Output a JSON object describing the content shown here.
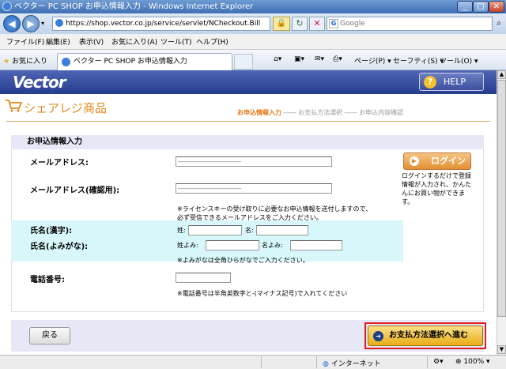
{
  "window": {
    "title": "ベクター PC SHOP お申込情報入力 - Windows Internet Explorer"
  },
  "address_bar": {
    "url": "https://shop.vector.co.jp/service/servlet/NCheckout.Bill",
    "search_placeholder": "Google"
  },
  "menu": [
    "ファイル(F)",
    "編集(E)",
    "表示(V)",
    "お気に入り(A)",
    "ツール(T)",
    "ヘルプ(H)"
  ],
  "favorites_label": "お気に入り",
  "tab": {
    "label": "ベクター PC SHOP お申込情報入力"
  },
  "commands": [
    "ページ(P) ▾",
    "セーフティ(S) ▾",
    "ツール(O) ▾"
  ],
  "site": {
    "logo": "Vector",
    "help_label": "HELP",
    "page_title": "シェアレジ商品",
    "steps": {
      "step1": "お申込情報入力",
      "sep": " ―― ",
      "step2": "お支払方法選択",
      "step3": "お申込内容確認"
    }
  },
  "form": {
    "section_title": "お申込情報入力",
    "email_label": "メールアドレス:",
    "email_value": "――――――――――",
    "email_confirm_label": "メールアドレス(確認用):",
    "email_confirm_value": "――――――――――",
    "email_note_1": "※ライセンスキーの受け取りに必要なお申込情報を送付しますので、",
    "email_note_2": "必ず受信できるメールアドレスをご入力ください。",
    "name_kanji_label": "氏名(漢字):",
    "sei_label": "姓:",
    "sei_value": "",
    "mei_label": "名:",
    "mei_value": "",
    "name_kana_label": "氏名(よみがな):",
    "sei_kana_label": "姓よみ:",
    "sei_kana_value": "",
    "mei_kana_label": "名よみ:",
    "mei_kana_value": "",
    "kana_note": "※よみがなは全角ひらがなでご入力ください。",
    "phone_label": "電話番号:",
    "phone_value": "",
    "phone_note": "※電話番号は半角英数字と-(マイナス記号)で入れてください"
  },
  "login": {
    "button_label": "ログイン",
    "note_1": "ログインするだけで登録",
    "note_2": "情報が入力され、かんた",
    "note_3": "んにお買い物ができま",
    "note_4": "す。"
  },
  "buttons": {
    "back": "戻る",
    "next": "お支払方法選択へ進む"
  },
  "status": {
    "zone": "インターネット",
    "zoom": "100%"
  }
}
